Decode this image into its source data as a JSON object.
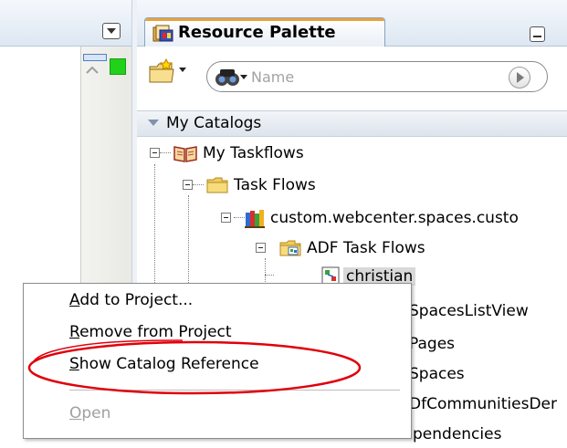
{
  "palette": {
    "title": "Resource Palette",
    "search": {
      "placeholder": "Name"
    },
    "section_header": "My Catalogs",
    "tree": [
      {
        "label": "My Taskflows",
        "level": 0,
        "icon": "book-icon"
      },
      {
        "label": "Task Flows",
        "level": 1,
        "icon": "folder-icon"
      },
      {
        "label": "custom.webcenter.spaces.custo",
        "level": 2,
        "icon": "library-icon"
      },
      {
        "label": "ADF Task Flows",
        "level": 3,
        "icon": "taskflow-folder-icon"
      },
      {
        "label": "christian",
        "level": 4,
        "icon": "taskflow-icon",
        "selected": true
      },
      {
        "label": "SpacesListView",
        "level": 4
      },
      {
        "label": "Pages",
        "level": 4
      },
      {
        "label": "Spaces",
        "level": 4
      },
      {
        "label": "DfCommunitiesDer",
        "level": 4
      },
      {
        "label": "pendencies",
        "level": 4
      }
    ]
  },
  "context_menu": {
    "items": [
      {
        "mnemonic": "A",
        "rest": "dd to Project...",
        "enabled": true
      },
      {
        "mnemonic": "R",
        "rest": "emove from Project",
        "enabled": true
      },
      {
        "mnemonic": "S",
        "rest": "how Catalog Reference",
        "enabled": true,
        "highlighted_by_annotation": true
      },
      {
        "mnemonic": "O",
        "rest": "pen",
        "enabled": false
      }
    ]
  },
  "colors": {
    "annotation_ellipse": "#e0000b",
    "status_marker": "#22d11a",
    "tab_accent": "#e9a23b"
  }
}
